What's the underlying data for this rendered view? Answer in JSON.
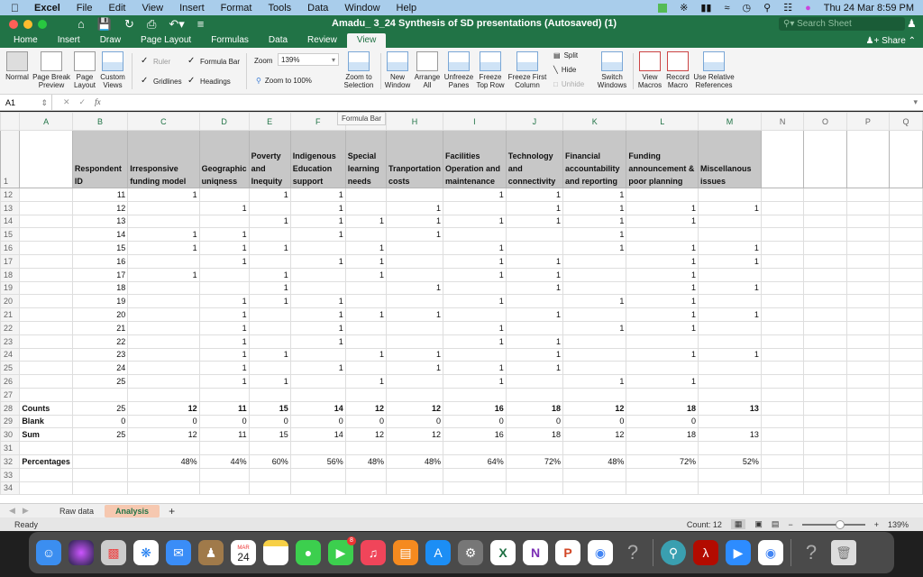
{
  "menubar": {
    "items": [
      "Excel",
      "File",
      "Edit",
      "View",
      "Insert",
      "Format",
      "Tools",
      "Data",
      "Window",
      "Help"
    ],
    "clock": "Thu 24 Mar  8:59 PM"
  },
  "window": {
    "title": "Amadu_ 3_24 Synthesis of SD presentations (Autosaved) (1)",
    "search_placeholder": "Search Sheet",
    "share_label": "Share"
  },
  "ribbon_tabs": [
    "Home",
    "Insert",
    "Draw",
    "Page Layout",
    "Formulas",
    "Data",
    "Review",
    "View"
  ],
  "active_ribbon_tab": "View",
  "ribbon": {
    "views": [
      "Normal",
      "Page Break Preview",
      "Page Layout",
      "Custom Views"
    ],
    "show": {
      "ruler": {
        "label": "Ruler",
        "checked": true,
        "disabled": true
      },
      "formula_bar": {
        "label": "Formula Bar",
        "checked": true
      },
      "gridlines": {
        "label": "Gridlines",
        "checked": true
      },
      "headings": {
        "label": "Headings",
        "checked": true
      }
    },
    "zoom_label": "Zoom",
    "zoom_value": "139%",
    "zoom_100": "Zoom to 100%",
    "zoom_selection": "Zoom to Selection",
    "window": [
      "New Window",
      "Arrange All",
      "Unfreeze Panes",
      "Freeze Top Row",
      "Freeze First Column"
    ],
    "split": "Split",
    "hide": "Hide",
    "unhide": "Unhide",
    "switch": "Switch Windows",
    "macros": [
      "View Macros",
      "Record Macro",
      "Use Relative References"
    ]
  },
  "formula_bar": {
    "name_box": "A1",
    "content": "",
    "tooltip": "Formula Bar"
  },
  "columns": [
    "A",
    "B",
    "C",
    "D",
    "E",
    "F",
    "G",
    "H",
    "I",
    "J",
    "K",
    "L",
    "M",
    "N",
    "O",
    "P",
    "Q"
  ],
  "header_row": {
    "row": "1",
    "cells": [
      "",
      "Respondent ID",
      "Irresponsive funding model",
      "Geographic uniqness",
      "Poverty and Inequity",
      "Indigenous Education support",
      "Special learning needs",
      "Tranportation costs",
      "Facilities Operation and maintenance",
      "Technology and connectivity",
      "Financial accountability and reporting",
      "Funding announcement & poor planning",
      "Miscellanous issues"
    ]
  },
  "rows": [
    {
      "row": "12",
      "cells": [
        "",
        "11",
        "1",
        "",
        "1",
        "1",
        "",
        "",
        "1",
        "1",
        "1",
        "",
        ""
      ]
    },
    {
      "row": "13",
      "cells": [
        "",
        "12",
        "",
        "1",
        "",
        "1",
        "",
        "1",
        "",
        "1",
        "1",
        "1",
        "1"
      ]
    },
    {
      "row": "14",
      "cells": [
        "",
        "13",
        "",
        "",
        "1",
        "1",
        "1",
        "1",
        "1",
        "1",
        "1",
        "1",
        ""
      ]
    },
    {
      "row": "15",
      "cells": [
        "",
        "14",
        "1",
        "1",
        "",
        "1",
        "",
        "1",
        "",
        "",
        "1",
        "",
        ""
      ]
    },
    {
      "row": "16",
      "cells": [
        "",
        "15",
        "1",
        "1",
        "1",
        "",
        "1",
        "",
        "1",
        "",
        "1",
        "1",
        "1"
      ]
    },
    {
      "row": "17",
      "cells": [
        "",
        "16",
        "",
        "1",
        "",
        "1",
        "1",
        "",
        "1",
        "1",
        "",
        "1",
        "1"
      ]
    },
    {
      "row": "18",
      "cells": [
        "",
        "17",
        "1",
        "",
        "1",
        "",
        "1",
        "",
        "1",
        "1",
        "",
        "1",
        ""
      ]
    },
    {
      "row": "19",
      "cells": [
        "",
        "18",
        "",
        "",
        "1",
        "",
        "",
        "1",
        "",
        "1",
        "",
        "1",
        "1"
      ]
    },
    {
      "row": "20",
      "cells": [
        "",
        "19",
        "",
        "1",
        "1",
        "1",
        "",
        "",
        "1",
        "",
        "1",
        "1",
        ""
      ]
    },
    {
      "row": "21",
      "cells": [
        "",
        "20",
        "",
        "1",
        "",
        "1",
        "1",
        "1",
        "",
        "1",
        "",
        "1",
        "1"
      ]
    },
    {
      "row": "22",
      "cells": [
        "",
        "21",
        "",
        "1",
        "",
        "1",
        "",
        "",
        "1",
        "",
        "1",
        "1",
        ""
      ]
    },
    {
      "row": "23",
      "cells": [
        "",
        "22",
        "",
        "1",
        "",
        "1",
        "",
        "",
        "1",
        "1",
        "",
        "",
        ""
      ]
    },
    {
      "row": "24",
      "cells": [
        "",
        "23",
        "",
        "1",
        "1",
        "",
        "1",
        "1",
        "",
        "1",
        "",
        "1",
        "1"
      ]
    },
    {
      "row": "25",
      "cells": [
        "",
        "24",
        "",
        "1",
        "",
        "1",
        "",
        "1",
        "1",
        "1",
        "",
        "",
        ""
      ]
    },
    {
      "row": "26",
      "cells": [
        "",
        "25",
        "",
        "1",
        "1",
        "",
        "1",
        "",
        "1",
        "",
        "1",
        "1",
        ""
      ]
    },
    {
      "row": "27",
      "cells": [
        "",
        "",
        "",
        "",
        "",
        "",
        "",
        "",
        "",
        "",
        "",
        "",
        ""
      ]
    },
    {
      "row": "28",
      "cells": [
        "Counts",
        "25",
        "12",
        "11",
        "15",
        "14",
        "12",
        "12",
        "16",
        "18",
        "12",
        "18",
        "13"
      ],
      "bold": true
    },
    {
      "row": "29",
      "cells": [
        "Blank",
        "0",
        "0",
        "0",
        "0",
        "0",
        "0",
        "0",
        "0",
        "0",
        "0",
        "0",
        ""
      ]
    },
    {
      "row": "30",
      "cells": [
        "Sum",
        "25",
        "12",
        "11",
        "15",
        "14",
        "12",
        "12",
        "16",
        "18",
        "12",
        "18",
        "13"
      ]
    },
    {
      "row": "31",
      "cells": [
        "",
        "",
        "",
        "",
        "",
        "",
        "",
        "",
        "",
        "",
        "",
        "",
        ""
      ]
    },
    {
      "row": "32",
      "cells": [
        "Percentages",
        "",
        "48%",
        "44%",
        "60%",
        "56%",
        "48%",
        "48%",
        "64%",
        "72%",
        "48%",
        "72%",
        "52%"
      ]
    },
    {
      "row": "33",
      "cells": [
        "",
        "",
        "",
        "",
        "",
        "",
        "",
        "",
        "",
        "",
        "",
        "",
        ""
      ]
    },
    {
      "row": "34",
      "cells": [
        "",
        "",
        "",
        "",
        "",
        "",
        "",
        "",
        "",
        "",
        "",
        "",
        ""
      ]
    }
  ],
  "sheet_tabs": [
    "Raw data",
    "Analysis"
  ],
  "active_sheet": "Analysis",
  "status": {
    "mode": "Ready",
    "count": "Count: 12",
    "zoom": "139%",
    "zoom_fraction": 0.62
  },
  "dock": {
    "apps": [
      "finder",
      "siri",
      "launchpad",
      "safari",
      "mail",
      "contacts",
      "calendar",
      "notes",
      "messages",
      "facetime",
      "music",
      "books",
      "app-store",
      "system-preferences",
      "excel",
      "onenote",
      "powerpoint",
      "chrome",
      "unknown-app",
      "preview-search",
      "acrobat",
      "zoom",
      "chrome-app",
      "unknown-app",
      "trash"
    ],
    "calendar_month": "MAR",
    "calendar_day": "24",
    "facetime_badge": "8"
  }
}
